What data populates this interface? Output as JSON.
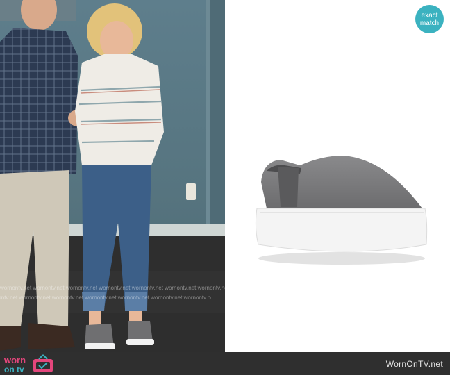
{
  "badge": {
    "line1": "exact",
    "line2": "match"
  },
  "watermark": {
    "text1": "wornontv.net  wornontv.net  wornontv.net  wornontv.net  wornontv.net  wornontv.net  wornontv.net",
    "text2": "wornontv.net  wornontv.net  wornontv.net  wornontv.net  wornontv.net  wornontv.net  wornontv.net"
  },
  "footer": {
    "logo_word1": "worn",
    "logo_word2": "on tv",
    "site_name": "WornOnTV.net"
  },
  "colors": {
    "badge": "#3bb2c0",
    "footer_bar": "#2f2f2f",
    "logo_pink": "#e4467c",
    "logo_teal": "#3bb2c0"
  }
}
